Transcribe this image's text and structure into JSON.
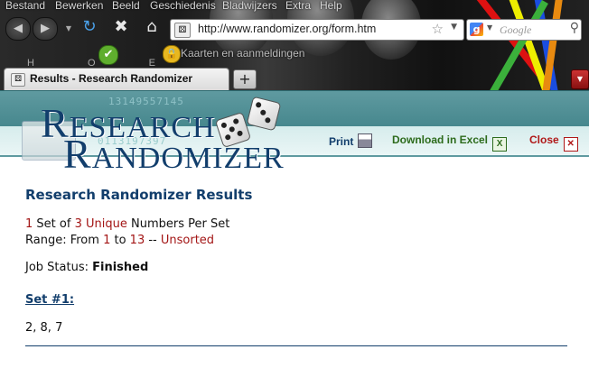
{
  "menu": [
    "Bestand",
    "Bewerken",
    "Beeld",
    "Geschiedenis",
    "Bladwijzers",
    "Extra",
    "Help"
  ],
  "browser": {
    "url": "http://www.randomizer.org/form.htm",
    "search_placeholder": "Google",
    "bookmark_label": "Kaarten en aanmeldingen",
    "bookmark_letters": "H O E",
    "tab_title": "Results - Research Randomizer",
    "new_tab": "+"
  },
  "logo": {
    "line1_cap": "R",
    "line1_rest": "ESEARCH",
    "line2_cap": "R",
    "line2_rest": "ANDOMIZER",
    "digits_top": "13149557145",
    "digits_bottom": "0113197397"
  },
  "actions": {
    "print": "Print",
    "excel": "Download in Excel",
    "close": "Close"
  },
  "results": {
    "title": "Research Randomizer Results",
    "num_sets": "1",
    "set_of": " Set of ",
    "per_set_count": "3",
    "unique": "Unique",
    "numbers_per_set": " Numbers Per Set",
    "range_label": "Range: From ",
    "range_from": "1",
    "to_label": " to ",
    "range_to": "13",
    "separator": " -- ",
    "order": "Unsorted",
    "job_status_label": "Job Status: ",
    "job_status_value": "Finished",
    "set_title": "Set #1:",
    "numbers": "2, 8, 7"
  },
  "colors": {
    "header_teal": "#46878d",
    "navy": "#123e6c",
    "highlight_red": "#a31515",
    "excel_green": "#2d6b1c"
  },
  "icons": [
    "back-icon",
    "forward-icon",
    "reload-icon",
    "home-icon",
    "stop-icon",
    "star-icon",
    "search-magnifier-icon",
    "printer-icon",
    "excel-icon",
    "close-x-icon",
    "dice-icon"
  ]
}
